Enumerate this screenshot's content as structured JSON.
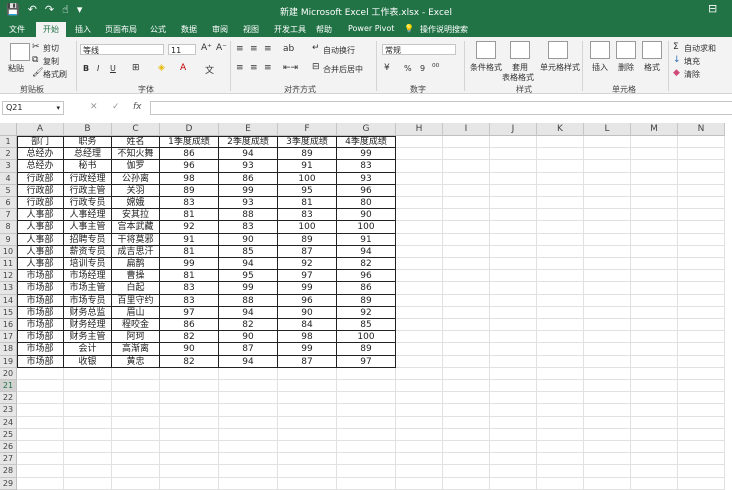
{
  "window": {
    "title": "新建 Microsoft Excel 工作表.xlsx  -  Excel"
  },
  "ribbon_tabs": [
    "文件",
    "开始",
    "插入",
    "页面布局",
    "公式",
    "数据",
    "审阅",
    "视图",
    "开发工具",
    "帮助",
    "Power Pivot"
  ],
  "active_tab": "开始",
  "tell_me": "操作说明搜索",
  "ribbon": {
    "paste": "粘贴",
    "cut": "剪切",
    "copy": "复制",
    "format_painter": "格式刷",
    "clipboard": "剪贴板",
    "font_name": "等线",
    "font_size": "11",
    "bold": "B",
    "italic": "I",
    "underline": "U",
    "font": "字体",
    "wrap_text": "自动换行",
    "merge_center": "合并后居中",
    "alignment": "对齐方式",
    "number_format": "常规",
    "percent": "%",
    "comma": "9",
    "number": "数字",
    "conditional_format": "条件格式",
    "format_as_table_1": "套用",
    "format_as_table_2": "表格格式",
    "cell_styles": "单元格样式",
    "styles": "样式",
    "insert": "插入",
    "delete": "删除",
    "format": "格式",
    "cells": "单元格",
    "autosum": "自动求和",
    "fill": "填充",
    "clear": "清除"
  },
  "formula_bar": {
    "name_box": "Q21",
    "cancel": "✕",
    "enter": "✓",
    "fx": "fx",
    "value": ""
  },
  "columns": [
    "A",
    "B",
    "C",
    "D",
    "E",
    "F",
    "G",
    "H",
    "I",
    "J",
    "K",
    "L",
    "M",
    "N"
  ],
  "rows": [
    "1",
    "2",
    "3",
    "4",
    "5",
    "6",
    "7",
    "8",
    "9",
    "10",
    "11",
    "12",
    "13",
    "14",
    "15",
    "16",
    "17",
    "18",
    "19",
    "20",
    "21",
    "22",
    "23",
    "24",
    "25",
    "26",
    "27",
    "28",
    "29"
  ],
  "selected_row": "21",
  "table": {
    "header": [
      "部门",
      "职务",
      "姓名",
      "1季度成绩",
      "2季度成绩",
      "3季度成绩",
      "4季度成绩"
    ],
    "body": [
      [
        "总经办",
        "总经理",
        "不知火舞",
        "86",
        "94",
        "89",
        "99"
      ],
      [
        "总经办",
        "秘书",
        "伽罗",
        "96",
        "93",
        "91",
        "83"
      ],
      [
        "行政部",
        "行政经理",
        "公孙离",
        "98",
        "86",
        "100",
        "93"
      ],
      [
        "行政部",
        "行政主管",
        "关羽",
        "89",
        "99",
        "95",
        "96"
      ],
      [
        "行政部",
        "行政专员",
        "嫦娥",
        "83",
        "93",
        "81",
        "80"
      ],
      [
        "人事部",
        "人事经理",
        "安其拉",
        "81",
        "88",
        "83",
        "90"
      ],
      [
        "人事部",
        "人事主管",
        "宫本武藏",
        "92",
        "83",
        "100",
        "100"
      ],
      [
        "人事部",
        "招聘专员",
        "干将莫邪",
        "91",
        "90",
        "89",
        "91"
      ],
      [
        "人事部",
        "薪资专员",
        "成吉思汗",
        "81",
        "85",
        "87",
        "94"
      ],
      [
        "人事部",
        "培训专员",
        "扁鹊",
        "99",
        "94",
        "92",
        "82"
      ],
      [
        "市场部",
        "市场经理",
        "曹操",
        "81",
        "95",
        "97",
        "96"
      ],
      [
        "市场部",
        "市场主管",
        "白起",
        "83",
        "99",
        "99",
        "86"
      ],
      [
        "市场部",
        "市场专员",
        "百里守约",
        "83",
        "88",
        "96",
        "89"
      ],
      [
        "市场部",
        "财务总监",
        "眉山",
        "97",
        "94",
        "90",
        "92"
      ],
      [
        "市场部",
        "财务经理",
        "程咬金",
        "86",
        "82",
        "84",
        "85"
      ],
      [
        "市场部",
        "财务主管",
        "阿珂",
        "82",
        "90",
        "98",
        "100"
      ],
      [
        "市场部",
        "会计",
        "高渐离",
        "90",
        "87",
        "99",
        "89"
      ],
      [
        "市场部",
        "收银",
        "黄忠",
        "82",
        "94",
        "87",
        "97"
      ]
    ]
  },
  "colors": {
    "excel_green": "#217346",
    "ribbon_bg": "#f3f3f3"
  }
}
